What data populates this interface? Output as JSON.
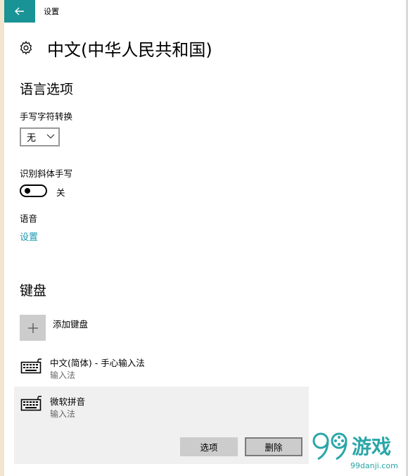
{
  "window": {
    "title": "设置"
  },
  "page": {
    "title": "中文(中华人民共和国)"
  },
  "language_options": {
    "heading": "语言选项",
    "handwriting_label": "手写字符转换",
    "handwriting_value": "无",
    "italic_label": "识别斜体手写",
    "italic_toggle": {
      "state": "关",
      "on": false
    },
    "speech_label": "语音",
    "speech_link": "设置"
  },
  "keyboard": {
    "heading": "键盘",
    "add_label": "添加键盘",
    "items": [
      {
        "name": "中文(简体) - 手心输入法",
        "type": "输入法",
        "selected": false
      },
      {
        "name": "微软拼音",
        "type": "输入法",
        "selected": true
      }
    ],
    "options_button": "选项",
    "remove_button": "删除"
  },
  "watermark": {
    "text": "游戏",
    "subtext": "99danji.com"
  },
  "colors": {
    "accent": "#1a9396",
    "link": "#1a9ab0",
    "selected_bg": "#f0f0f0",
    "button_bg": "#cccccc"
  },
  "icons": [
    "back-arrow-icon",
    "gear-icon",
    "chevron-down-icon",
    "plus-icon",
    "keyboard-icon"
  ]
}
